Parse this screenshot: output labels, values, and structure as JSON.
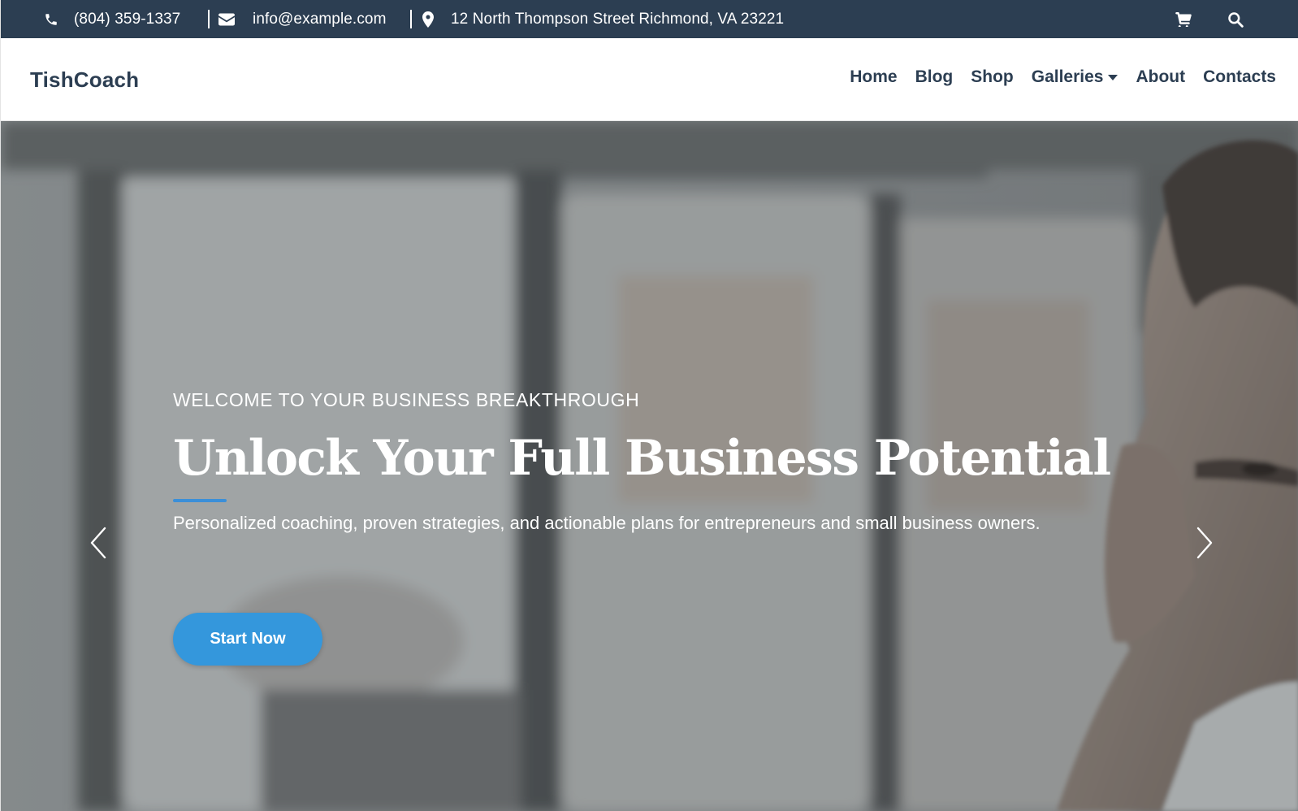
{
  "topbar": {
    "phone": "(804) 359-1337",
    "email": "info@example.com",
    "address": "12 North Thompson Street Richmond, VA 23221",
    "icons": [
      "phone-icon",
      "envelope-icon",
      "map-marker-icon",
      "shopping-cart-icon",
      "search-icon"
    ]
  },
  "navbar": {
    "brand": "TishCoach",
    "menu": [
      {
        "label": "Home"
      },
      {
        "label": "Blog"
      },
      {
        "label": "Shop"
      },
      {
        "label": "Galleries",
        "dropdown": true
      },
      {
        "label": "About"
      },
      {
        "label": "Contacts"
      }
    ]
  },
  "hero": {
    "eyebrow": "WELCOME TO YOUR BUSINESS BREAKTHROUGH",
    "title": "Unlock Your Full Business Potential",
    "subtitle": "Personalized coaching, proven strategies, and actionable plans for entrepreneurs and small business owners.",
    "cta_label": "Start Now",
    "controls": [
      "chevron-left-icon",
      "chevron-right-icon"
    ]
  },
  "colors": {
    "topbar_bg": "#2c3e52",
    "nav_text": "#2c3e52",
    "accent": "#3497dc",
    "text_light": "#ffffff"
  }
}
